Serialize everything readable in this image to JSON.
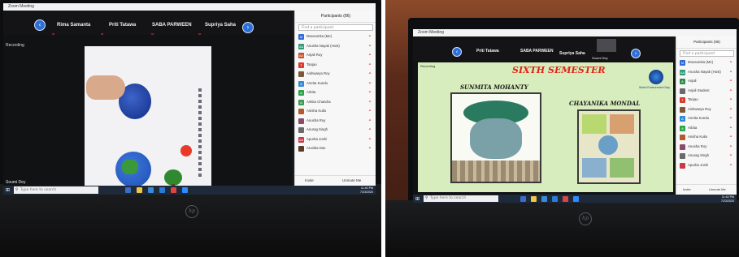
{
  "left_photo": {
    "window_title": "Zoom Meeting",
    "side_label": "Recording",
    "participants_strip": [
      "Rima Samanta",
      "Priti Tatawa",
      "SABA PARWEEN",
      "Supriya Saha"
    ],
    "panel_title": "Participants (86)",
    "panel_search": "Find a participant",
    "panel_rows": [
      {
        "initials": "M",
        "name": "Mousumita (Me)",
        "color": "#2f6bd6"
      },
      {
        "initials": "AA",
        "name": "Anusha Nayak (Host)",
        "color": "#2e9a7a"
      },
      {
        "initials": "AA",
        "name": "Anjali Roy",
        "color": "#c84f2a"
      },
      {
        "initials": "T",
        "name": "Tanjau",
        "color": "#d93a2a"
      },
      {
        "initials": "",
        "name": "Aishwarya Roy",
        "color": "#7a5a3a"
      },
      {
        "initials": "A",
        "name": "Amrita Kundu",
        "color": "#2e8bd6"
      },
      {
        "initials": "A",
        "name": "Arbita",
        "color": "#2fa14a"
      },
      {
        "initials": "A",
        "name": "Ankita Chandra",
        "color": "#3a9a5a"
      },
      {
        "initials": "",
        "name": "Anisha Kuila",
        "color": "#b05a30"
      },
      {
        "initials": "",
        "name": "Anusha Roy",
        "color": "#8a4a6a"
      },
      {
        "initials": "",
        "name": "Anurag Singh",
        "color": "#6a6a6a"
      },
      {
        "initials": "AA",
        "name": "Apurba Joshi",
        "color": "#c83a4a"
      },
      {
        "initials": "",
        "name": "Arunika Das",
        "color": "#5a3a2a"
      }
    ],
    "panel_footer": [
      "Invite",
      "Unmute Me"
    ],
    "bottom_label": "Soumi Dey",
    "taskbar_search": "Type here to search",
    "clock": [
      "11:40 PM",
      "7/23/2020"
    ]
  },
  "right_photo": {
    "window_title": "Zoom Meeting",
    "side_label": "Recording",
    "participants_strip": [
      "Priti Tatawa",
      "SABA PARWEEN",
      "Supriya Saha",
      "Soumi Dey"
    ],
    "panel_title": "Participants (86)",
    "panel_search": "Find a participant",
    "panel_rows": [
      {
        "initials": "M",
        "name": "Mousumita (Me)",
        "color": "#2f6bd6"
      },
      {
        "initials": "AA",
        "name": "Anusha Nayak (Host)",
        "color": "#2e9a7a"
      },
      {
        "initials": "A",
        "name": "Anjali",
        "color": "#2f8a4a"
      },
      {
        "initials": "",
        "name": "Anjali Student",
        "color": "#6a6a6a"
      },
      {
        "initials": "T",
        "name": "Tanjau",
        "color": "#d93a2a"
      },
      {
        "initials": "",
        "name": "Aishwarya Roy",
        "color": "#7a5a3a"
      },
      {
        "initials": "A",
        "name": "Amrita Kundu",
        "color": "#2e8bd6"
      },
      {
        "initials": "A",
        "name": "Arbita",
        "color": "#2fa14a"
      },
      {
        "initials": "",
        "name": "Anisha Kuila",
        "color": "#b05a30"
      },
      {
        "initials": "",
        "name": "Anusha Roy",
        "color": "#8a4a6a"
      },
      {
        "initials": "",
        "name": "Anurag Singh",
        "color": "#6a6a6a"
      },
      {
        "initials": "",
        "name": "Apurba Joshi",
        "color": "#c83a4a"
      }
    ],
    "panel_footer": [
      "Invite",
      "Unmute Me"
    ],
    "slide_title": "SIXTH SEMESTER",
    "poster1_name": "SUNMITA MOHANTY",
    "poster2_name": "CHAYANIKA  MONDAL",
    "emblem_caption": "World Environment Day",
    "taskbar_search": "Type here to search",
    "clock": [
      "11:42 PM",
      "7/23/2020"
    ]
  },
  "colors": {
    "zoom_blue": "#2d6fd6",
    "slide_background": "#d7edbd",
    "slide_title": "#e02418",
    "taskbar": "#1e2a3a"
  }
}
